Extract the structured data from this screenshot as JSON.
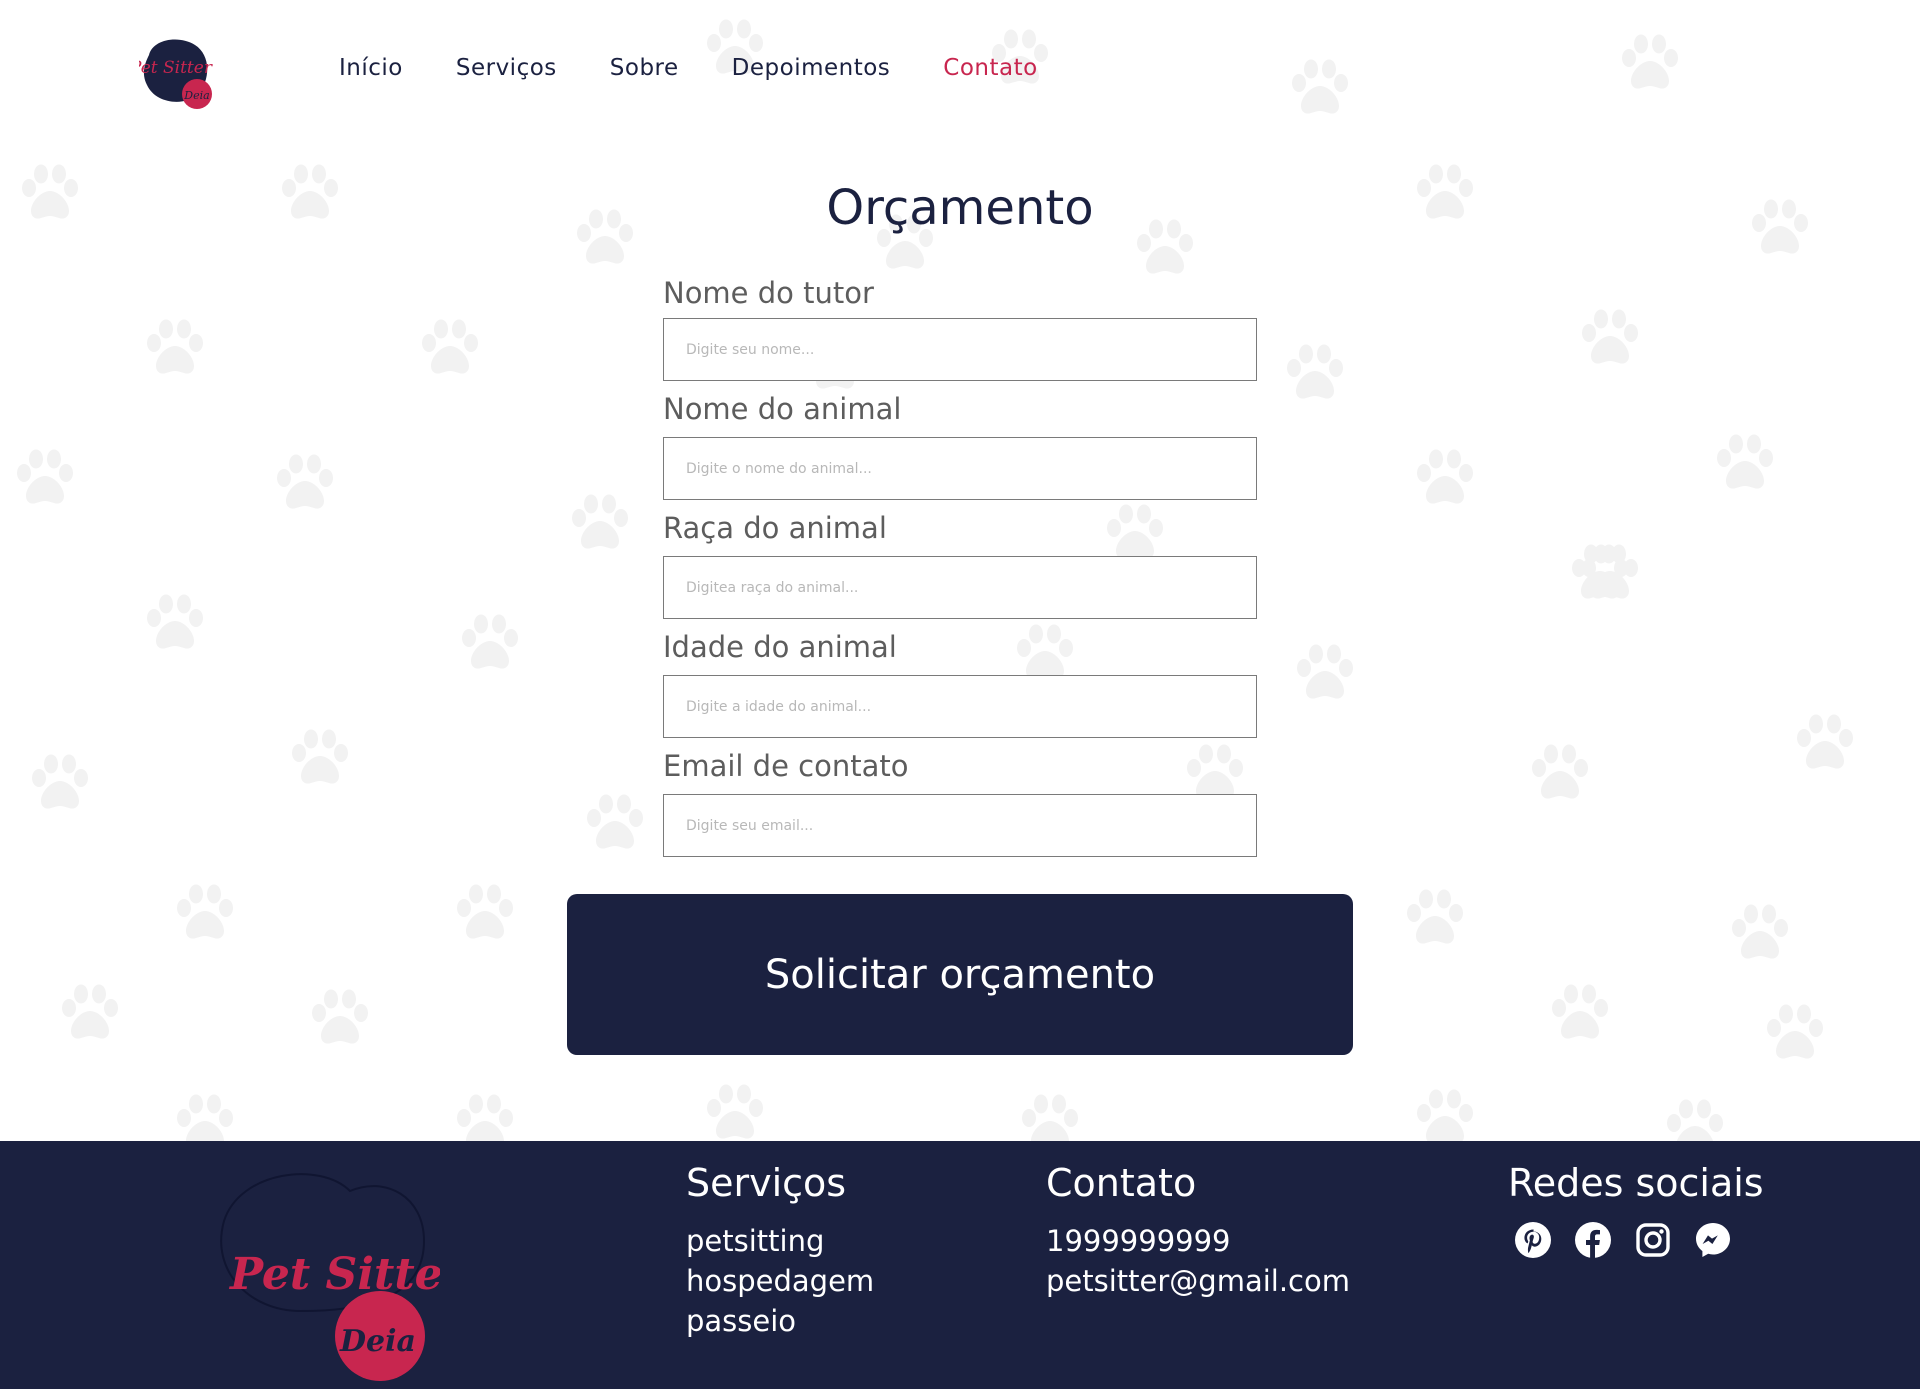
{
  "nav": {
    "items": [
      "Início",
      "Serviços",
      "Sobre",
      "Depoimentos",
      "Contato"
    ],
    "active_index": 4
  },
  "form": {
    "title": "Orçamento",
    "fields": [
      {
        "label": "Nome do tutor",
        "placeholder": "Digite seu nome..."
      },
      {
        "label": "Nome do animal",
        "placeholder": "Digite o nome do animal..."
      },
      {
        "label": "Raça do animal",
        "placeholder": "Digitea raça do animal..."
      },
      {
        "label": "Idade do animal",
        "placeholder": "Digite a idade do animal..."
      },
      {
        "label": "Email de contato",
        "placeholder": "Digite seu email..."
      }
    ],
    "submit_label": "Solicitar orçamento"
  },
  "logo": {
    "line1": "Pet Sitter",
    "line2": "Deia"
  },
  "footer": {
    "services": {
      "title": "Serviços",
      "items": [
        "petsitting",
        "hospedagem",
        "passeio"
      ]
    },
    "contact": {
      "title": "Contato",
      "phone": "1999999999",
      "email": "petsitter@gmail.com"
    },
    "social": {
      "title": "Redes sociais",
      "icons": [
        "pinterest-icon",
        "facebook-icon",
        "instagram-icon",
        "messenger-icon"
      ]
    }
  },
  "colors": {
    "navy": "#1b2140",
    "accent": "#c8264f",
    "paw": "#f2f2f2",
    "label": "#5d5d5d"
  }
}
